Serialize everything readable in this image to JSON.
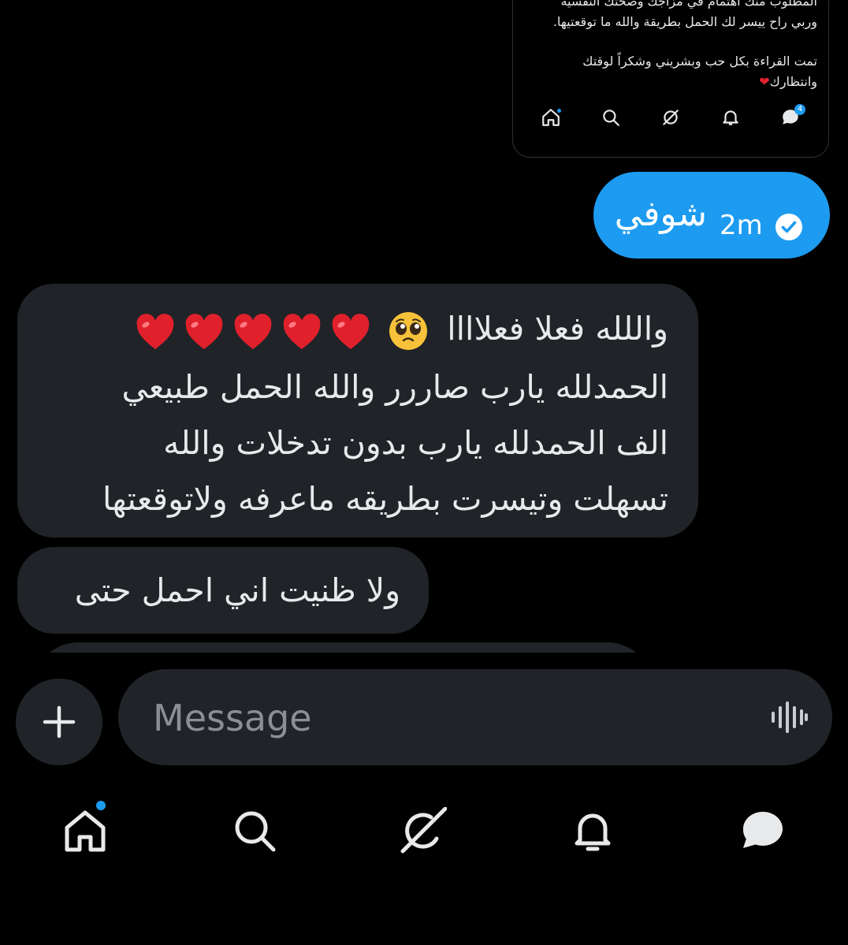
{
  "shared_post": {
    "lines": [
      "المطلوب منك اهتمام في مزاجك وصحتك النفسية",
      "وربي راح ييسر لك الحمل بطريقة والله ما توقعتيها.",
      "تمت القراءة بكل حب وبشريني وشكراً لوقتك",
      "وانتظارك"
    ],
    "messages_badge": "4"
  },
  "sent_message": {
    "text": "شوفي",
    "time": "2m"
  },
  "received_messages": {
    "first": {
      "line1": "واللله فعلا فعلاااا",
      "line2": "الحمدلله يارب صاررر والله الحمل طبيعي",
      "line3": "الف الحمدلله يارب بدون تدخلات والله",
      "line4": "تسهلت وتيسرت بطريقه ماعرفه ولاتوقعتها",
      "heart_count": 5
    },
    "second": {
      "text": "ولا ظنيت اني احمل حتى"
    }
  },
  "composer": {
    "placeholder": "Message",
    "value": ""
  },
  "bottom_nav": {
    "items": [
      "home-icon",
      "search-icon",
      "grok-icon",
      "bell-icon",
      "messages-icon"
    ],
    "home_has_notification_dot": true
  },
  "colors": {
    "accent": "#1d9bf0",
    "bubble_received": "#202327",
    "background": "#000000",
    "heart": "#e0212c"
  }
}
